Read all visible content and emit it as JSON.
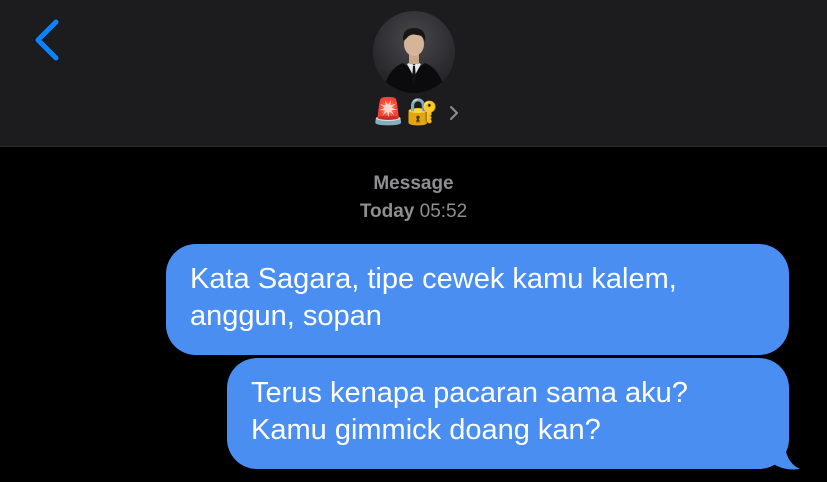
{
  "header": {
    "back_icon": "chevron-left-icon",
    "contact": {
      "avatar": "contact-photo",
      "name_emoji_1": "🚨",
      "name_emoji_2": "🔐",
      "details_icon": "chevron-right-icon"
    }
  },
  "conversation": {
    "service_label": "Message",
    "day_label": "Today",
    "time_label": "05:52",
    "messages": [
      {
        "direction": "outgoing",
        "line1": "Kata Sagara, tipe cewek kamu kalem,",
        "line2": "anggun, sopan"
      },
      {
        "direction": "outgoing",
        "line1": "Terus kenapa pacaran sama aku?",
        "line2": "Kamu gimmick doang kan?"
      }
    ]
  },
  "colors": {
    "accent": "#0a84ff",
    "bubble_outgoing": "#4a8ef1",
    "header_bg": "#1c1c1e",
    "background": "#000000",
    "meta_text": "#8e8e93"
  }
}
